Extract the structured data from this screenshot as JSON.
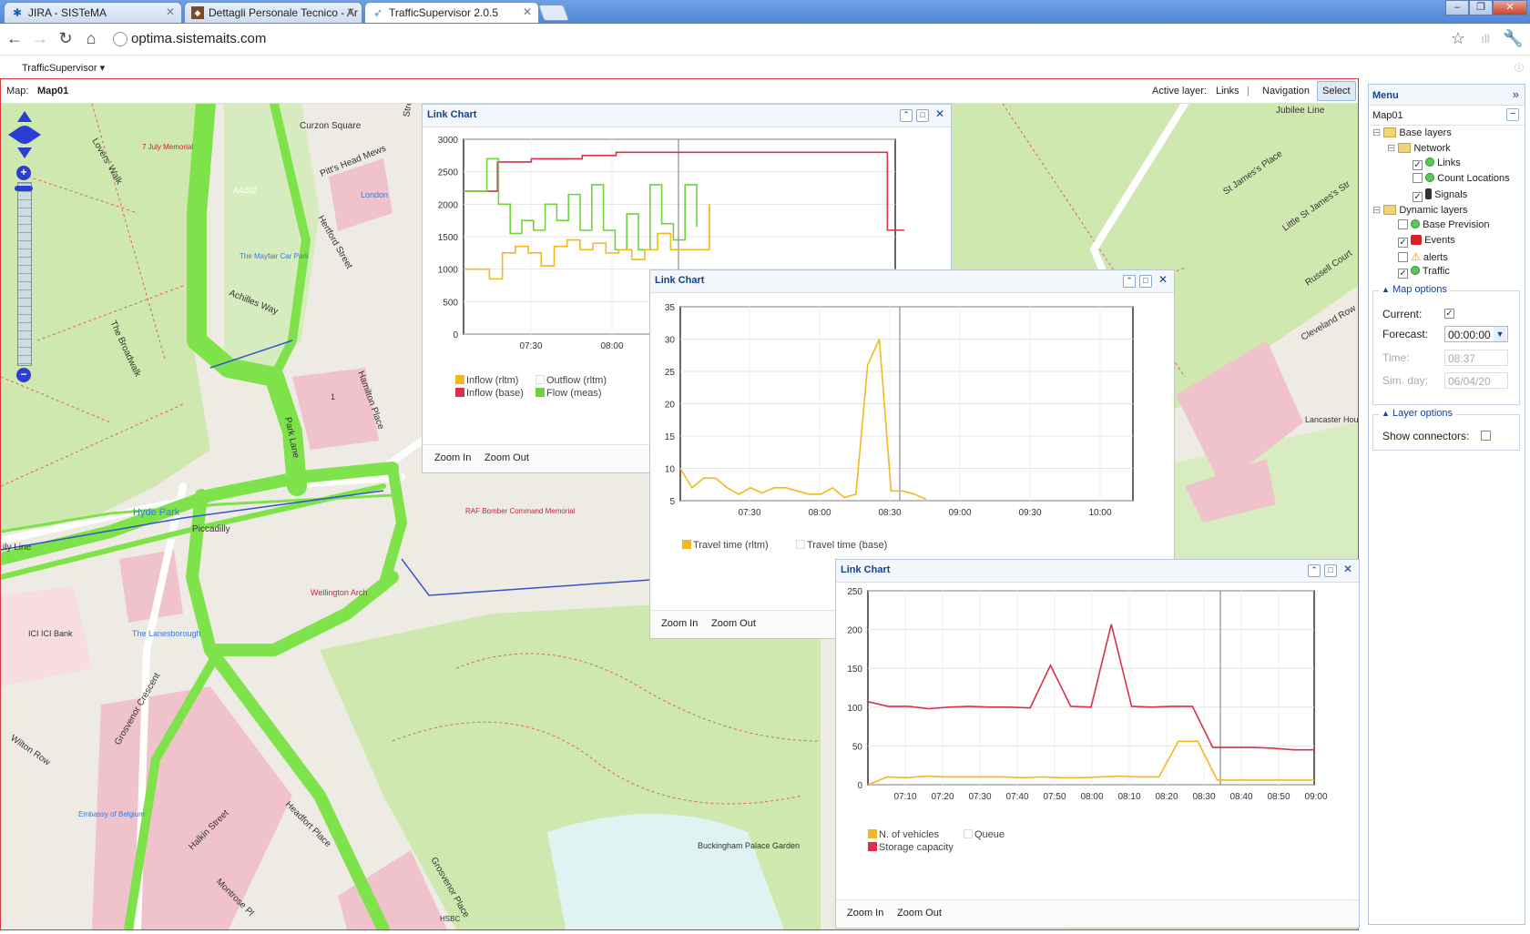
{
  "browser": {
    "tabs": [
      {
        "title": "JIRA - SISTeMA",
        "icon": "jira-icon"
      },
      {
        "title": "Dettagli Personale Tecnico - Ar",
        "icon": "app-icon"
      },
      {
        "title": "TrafficSupervisor 2.0.5",
        "icon": "bird-icon"
      }
    ],
    "url": "optima.sistemaits.com",
    "bookmark_menu": "TrafficSupervisor ▾"
  },
  "map_header": {
    "map_label": "Map:",
    "map_name": "Map01",
    "active_layer_label": "Active layer:",
    "active_layer": "Links",
    "separator": "|",
    "navigation": "Navigation",
    "select": "Select"
  },
  "map_labels": {
    "curzon_square": "Curzon Square",
    "pitts_head_mews": "Pitt's Head Mews",
    "hertford_street": "Hertford Street",
    "achilles_way": "Achilles Way",
    "hamilton_place": "Hamilton Place",
    "park_lane": "Park Lane",
    "lovers_walk": "Lovers' Walk",
    "the_broadwalk": "The Broadwalk",
    "july_memorial": "7 July Memorial",
    "a4202": "A4202",
    "mayfair_car_park": "The Mayfair Car Park",
    "london": "London",
    "hyde_park": "Hyde Park",
    "piccadilly": "Piccadilly",
    "raf_memorial": "RAF Bomber Command Memorial",
    "wellington_arch": "Wellington Arch",
    "ici_bank": "ICI ICI Bank",
    "the_lanesborough": "The Lanesborough",
    "grosvenor_crescent": "Grosvenor Crescent",
    "wilton_row": "Wilton Row",
    "halkin_street": "Halkin Street",
    "headfort_place": "Headfort Place",
    "embassy_belgium": "Embassy of Belgium",
    "montrose_pl": "Montrose Pl",
    "grosvenor_place": "Grosvenor Place",
    "hsbc": "HSBC",
    "buckingham_palace_garden": "Buckingham Palace Garden",
    "jubilee_line": "Jubilee Line",
    "st_james_place": "St James's Place",
    "little_st_james": "Little St James's Str",
    "russell_court": "Russell Court",
    "cleveland_row": "Cleveland Row",
    "lancaster_house": "Lancaster House",
    "street": "Street",
    "ily_line": "ily Line",
    "ldlng_no1": "1"
  },
  "charts": {
    "chart1": {
      "title": "Link Chart",
      "zoom_in": "Zoom In",
      "zoom_out": "Zoom Out",
      "legend": [
        "Inflow (rltm)",
        "Outflow (rltm)",
        "Inflow (base)",
        "Flow (meas)"
      ]
    },
    "chart2": {
      "title": "Link Chart",
      "zoom_in": "Zoom In",
      "zoom_out": "Zoom Out",
      "legend": [
        "Travel time (rltm)",
        "Travel time (base)"
      ]
    },
    "chart3": {
      "title": "Link Chart",
      "zoom_in": "Zoom In",
      "zoom_out": "Zoom Out",
      "legend": [
        "N. of vehicles",
        "Queue",
        "Storage capacity"
      ]
    }
  },
  "chart_data": [
    {
      "type": "line",
      "title": "Link Chart",
      "x_ticks": [
        "07:30",
        "08:00"
      ],
      "ylim": [
        0,
        3000
      ],
      "y_ticks": [
        0,
        500,
        1000,
        1500,
        2000,
        2500,
        3000
      ],
      "series": [
        {
          "name": "Inflow (base)",
          "color": "#d9304b",
          "values": [
            2200,
            2200,
            2650,
            2650,
            2700,
            2700,
            2700,
            2750,
            2750,
            2800,
            2800,
            2800,
            2800,
            2800,
            2800,
            2800,
            2800,
            2800,
            2800,
            2800,
            2800,
            2800,
            2800,
            2800,
            2800,
            1600,
            1600
          ]
        },
        {
          "name": "Flow (meas)",
          "color": "#6fd43a",
          "values": [
            2200,
            2200,
            2700,
            2000,
            1550,
            1750,
            1600,
            2000,
            1750,
            2150,
            1600,
            2300,
            1600,
            1300,
            1850,
            1300,
            2300,
            1700,
            1450,
            2300,
            1650
          ]
        },
        {
          "name": "Inflow (rltm)",
          "color": "#f2b81e",
          "values": [
            1000,
            1000,
            850,
            1250,
            1350,
            1250,
            1050,
            1350,
            1450,
            1300,
            1400,
            1250,
            1300,
            1150,
            1300,
            1550,
            1300,
            1300,
            1300,
            2000
          ]
        },
        {
          "name": "Outflow (rltm)",
          "color": "#cccccc",
          "values": []
        }
      ]
    },
    {
      "type": "line",
      "title": "Link Chart",
      "x_ticks": [
        "07:30",
        "08:00",
        "08:30",
        "09:00",
        "09:30",
        "10:00"
      ],
      "ylim": [
        5,
        35
      ],
      "y_ticks": [
        5,
        10,
        15,
        20,
        25,
        30,
        35
      ],
      "series": [
        {
          "name": "Travel time (rltm)",
          "color": "#f2b81e",
          "values": [
            10,
            7,
            8.5,
            8.5,
            7,
            6,
            7,
            6.2,
            7,
            7,
            6.5,
            6,
            6,
            7,
            5.5,
            6,
            26,
            30,
            6.5,
            6.5,
            6,
            5.2
          ]
        },
        {
          "name": "Travel time (base)",
          "color": "#cccccc",
          "values": []
        }
      ]
    },
    {
      "type": "line",
      "title": "Link Chart",
      "x_ticks": [
        "07:10",
        "07:20",
        "07:30",
        "07:40",
        "07:50",
        "08:00",
        "08:10",
        "08:20",
        "08:30",
        "08:40",
        "08:50",
        "09:00"
      ],
      "ylim": [
        0,
        250
      ],
      "y_ticks": [
        0,
        50,
        100,
        150,
        200,
        250
      ],
      "series": [
        {
          "name": "Storage capacity",
          "color": "#d9304b",
          "values": [
            107,
            101,
            101,
            98,
            100,
            101,
            100,
            100,
            99,
            154,
            101,
            100,
            207,
            101,
            100,
            101,
            101,
            48,
            48,
            48,
            47,
            45,
            45
          ]
        },
        {
          "name": "N. of vehicles",
          "color": "#f2b81e",
          "values": [
            0,
            10,
            9,
            11,
            10,
            10,
            10,
            10,
            9,
            10,
            9,
            9,
            10,
            11,
            10,
            10,
            56,
            56,
            6,
            6,
            6,
            6,
            6,
            6
          ]
        },
        {
          "name": "Queue",
          "color": "#cccccc",
          "values": []
        }
      ]
    }
  ],
  "menu": {
    "title": "Menu",
    "map_name": "Map01",
    "tree": {
      "base_layers": "Base layers",
      "network": "Network",
      "links": "Links",
      "count_locations": "Count Locations",
      "signals": "Signals",
      "dynamic_layers": "Dynamic layers",
      "base_prevision": "Base Prevision",
      "events": "Events",
      "alerts": "alerts",
      "traffic": "Traffic"
    },
    "checks": {
      "links": true,
      "count_locations": false,
      "signals": true,
      "base_prevision": false,
      "events": true,
      "alerts": false,
      "traffic": true
    },
    "map_options": {
      "legend": "Map options",
      "current_label": "Current:",
      "current_checked": true,
      "forecast_label": "Forecast:",
      "forecast_value": "00:00:00",
      "time_label": "Time:",
      "time_value": "08:37",
      "sim_day_label": "Sim. day:",
      "sim_day_value": "06/04/20"
    },
    "layer_options": {
      "legend": "Layer options",
      "show_connectors_label": "Show connectors:",
      "show_connectors_checked": false
    }
  },
  "colors": {
    "road_green": "#7ee34a",
    "pink_building": "#f0c2cc",
    "park": "#cfe8b0",
    "panel_blue": "#15428b"
  }
}
